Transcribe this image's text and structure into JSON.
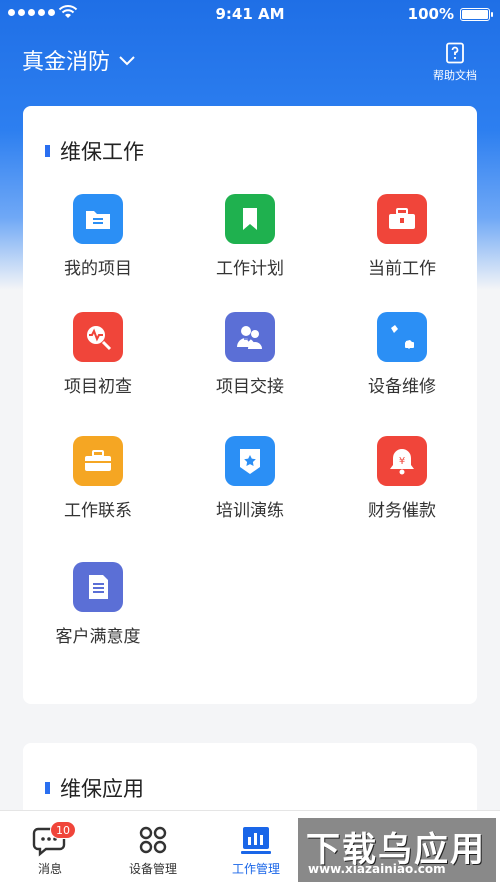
{
  "status": {
    "time": "9:41 AM",
    "battery": "100%"
  },
  "header": {
    "org_name": "真金消防",
    "help_label": "帮助文档"
  },
  "section1": {
    "title": "维保工作",
    "items": [
      {
        "label": "我的项目",
        "icon": "folder-icon",
        "color": "#2b8ff5"
      },
      {
        "label": "工作计划",
        "icon": "bookmark-icon",
        "color": "#1fb14f"
      },
      {
        "label": "当前工作",
        "icon": "toolbox-icon",
        "color": "#f0453a"
      },
      {
        "label": "项目初查",
        "icon": "inspect-icon",
        "color": "#f0453a"
      },
      {
        "label": "项目交接",
        "icon": "handover-icon",
        "color": "#5b6fd6"
      },
      {
        "label": "设备维修",
        "icon": "wrench-icon",
        "color": "#2b8ff5"
      },
      {
        "label": "工作联系",
        "icon": "briefcase-icon",
        "color": "#f5a623"
      },
      {
        "label": "培训演练",
        "icon": "badge-star-icon",
        "color": "#2b8ff5"
      },
      {
        "label": "财务催款",
        "icon": "money-bell-icon",
        "color": "#f0453a"
      },
      {
        "label": "客户满意度",
        "icon": "survey-icon",
        "color": "#5b6fd6"
      }
    ]
  },
  "section2": {
    "title": "维保应用"
  },
  "tabbar": {
    "tabs": [
      {
        "label": "消息",
        "icon": "message-icon",
        "badge": "10"
      },
      {
        "label": "设备管理",
        "icon": "grid-icon"
      },
      {
        "label": "工作管理",
        "icon": "chart-icon",
        "active": true
      }
    ]
  },
  "watermark": {
    "main": "下载乌应用",
    "url": "www.xiazainiao.com"
  }
}
